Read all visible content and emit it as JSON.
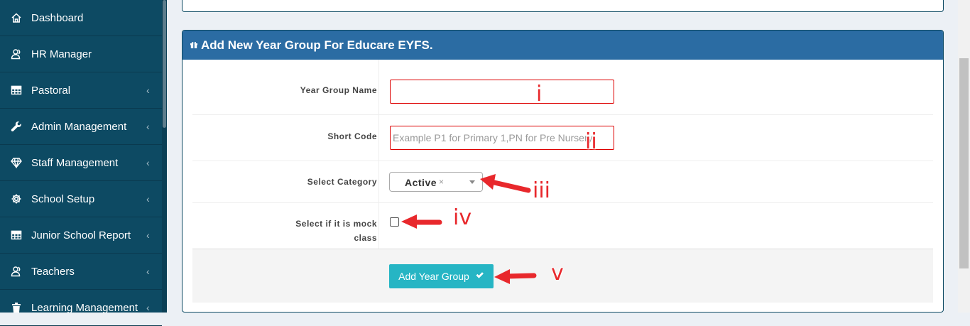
{
  "sidebar": {
    "items": [
      {
        "label": "Dashboard",
        "icon": "home-icon",
        "chevron": ""
      },
      {
        "label": "HR Manager",
        "icon": "users-icon",
        "chevron": ""
      },
      {
        "label": "Pastoral",
        "icon": "table-icon",
        "chevron": "‹"
      },
      {
        "label": "Admin Management",
        "icon": "wrench-icon",
        "chevron": "‹"
      },
      {
        "label": "Staff Management",
        "icon": "diamond-icon",
        "chevron": "‹"
      },
      {
        "label": "School Setup",
        "icon": "gear-icon",
        "chevron": "‹"
      },
      {
        "label": "Junior School Report",
        "icon": "table-icon",
        "chevron": "‹"
      },
      {
        "label": "Teachers",
        "icon": "users-icon",
        "chevron": "‹"
      },
      {
        "label": "Learning Management",
        "icon": "trash-icon",
        "chevron": "‹"
      }
    ]
  },
  "panel": {
    "title": "Add New Year Group For Educare EYFS."
  },
  "form": {
    "year_group_name_label": "Year Group Name",
    "year_group_name_value": "",
    "short_code_label": "Short Code",
    "short_code_placeholder": "Example P1 for Primary 1,PN for Pre Nursery",
    "category_label": "Select Category",
    "category_value": "Active",
    "category_clear": "×",
    "mock_label": "Select if it is mock class",
    "mock_checked": false,
    "submit_label": "Add Year Group"
  },
  "annotations": [
    "i",
    "ii",
    "iii",
    "iv",
    "v"
  ],
  "colors": {
    "sidebar": "#0d4a63",
    "panel_header": "#2b6ca3",
    "button": "#26b5c4",
    "annotation": "#e8282c",
    "input_border": "#dd0000"
  }
}
